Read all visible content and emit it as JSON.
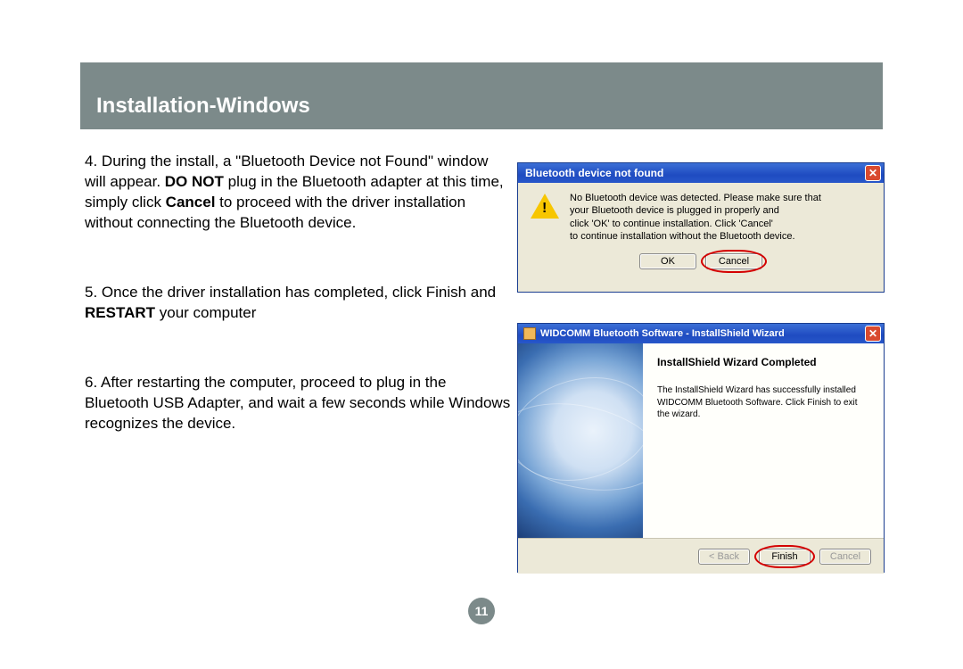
{
  "header": {
    "title": "Installation-Windows"
  },
  "steps": {
    "s4": {
      "num": "4.",
      "text_a": " During the install, a \"Bluetooth Device not Found\" window will appear.  ",
      "bold_a": "DO NOT",
      "text_b": " plug in the Bluetooth adapter at this time,  simply click ",
      "bold_b": "Cancel",
      "text_c": " to proceed with the driver installation without connecting the Bluetooth device."
    },
    "s5": {
      "num": "5.",
      "text_a": " Once the driver installation has completed, click Finish and ",
      "bold_a": "RESTART",
      "text_b": " your computer"
    },
    "s6": {
      "num": "6.",
      "text_a": " After restarting the computer, proceed to plug in the Bluetooth USB Adapter, and wait a few seconds while Windows recognizes the device."
    }
  },
  "dialog1": {
    "title": "Bluetooth device not found",
    "msg_l1": "No Bluetooth device was detected. Please make sure that",
    "msg_l2": "your Bluetooth device is plugged in properly and",
    "msg_l3": "click 'OK' to continue installation. Click 'Cancel'",
    "msg_l4": "to continue installation without the Bluetooth device.",
    "ok": "OK",
    "cancel": "Cancel",
    "close": "✕"
  },
  "dialog2": {
    "title": "WIDCOMM Bluetooth Software - InstallShield Wizard",
    "heading": "InstallShield Wizard Completed",
    "body": "The InstallShield Wizard has successfully installed WIDCOMM Bluetooth Software. Click Finish to exit the wizard.",
    "back": "< Back",
    "finish": "Finish",
    "cancel": "Cancel",
    "close": "✕"
  },
  "page_number": "11"
}
